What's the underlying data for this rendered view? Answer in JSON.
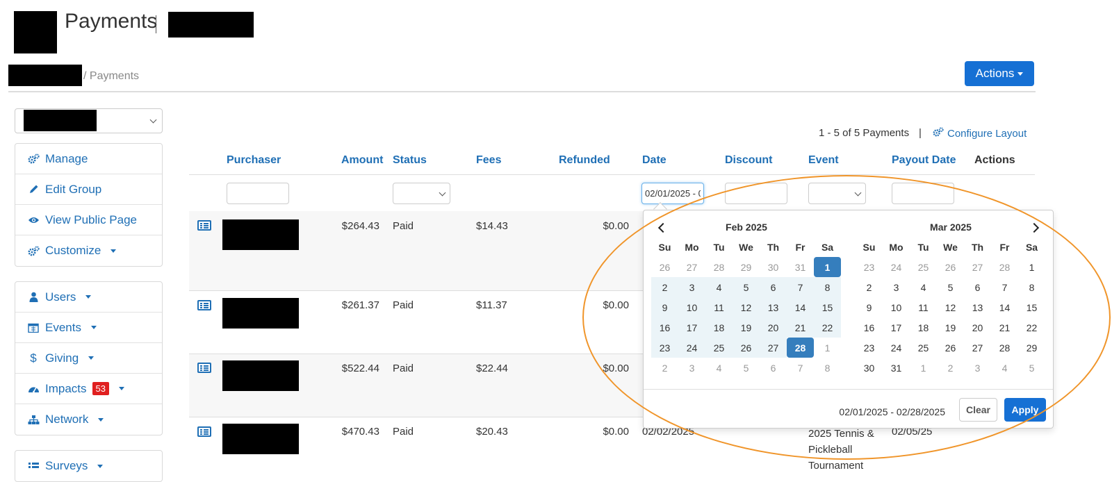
{
  "header": {
    "title": "Payments"
  },
  "breadcrumb": {
    "current": "/ Payments"
  },
  "actions_button": {
    "label": "Actions"
  },
  "sidebar": {
    "group1": [
      {
        "label": "Manage",
        "icon": "cogs-icon"
      },
      {
        "label": "Edit Group",
        "icon": "pencil-icon"
      },
      {
        "label": "View Public Page",
        "icon": "eye-icon"
      },
      {
        "label": "Customize",
        "icon": "cogs-icon"
      }
    ],
    "group2": [
      {
        "label": "Users",
        "icon": "user-icon"
      },
      {
        "label": "Events",
        "icon": "calendar-icon"
      },
      {
        "label": "Giving",
        "icon": "dollar-icon"
      },
      {
        "label": "Impacts",
        "icon": "dashboard-icon",
        "badge": "53"
      },
      {
        "label": "Network",
        "icon": "sitemap-icon"
      }
    ],
    "group3": [
      {
        "label": "Surveys",
        "icon": "list-icon"
      }
    ]
  },
  "summary": {
    "count_text": "1 - 5 of 5 Payments",
    "separator": "|",
    "configure_label": "Configure Layout"
  },
  "table": {
    "headers": {
      "purchaser": "Purchaser",
      "amount": "Amount",
      "status": "Status",
      "fees": "Fees",
      "refunded": "Refunded",
      "date": "Date",
      "discount": "Discount",
      "event": "Event",
      "payout_date": "Payout Date",
      "actions": "Actions"
    },
    "date_filter_value": "02/01/2025 - 02/28/2025",
    "rows": [
      {
        "amount": "$264.43",
        "status": "Paid",
        "fees": "$14.43",
        "refunded": "$0.00"
      },
      {
        "amount": "$261.37",
        "status": "Paid",
        "fees": "$11.37",
        "refunded": "$0.00"
      },
      {
        "amount": "$522.44",
        "status": "Paid",
        "fees": "$22.44",
        "refunded": "$0.00"
      },
      {
        "amount": "$470.43",
        "status": "Paid",
        "fees": "$20.43",
        "refunded": "$0.00",
        "date": "02/02/2025",
        "event": "2025 Tennis & Pickleball Tournament",
        "payout_date": "02/05/25"
      }
    ]
  },
  "datepicker": {
    "dow": [
      "Su",
      "Mo",
      "Tu",
      "We",
      "Th",
      "Fr",
      "Sa"
    ],
    "months": [
      {
        "label": "Feb 2025",
        "days": [
          [
            "26",
            "off"
          ],
          [
            "27",
            "off"
          ],
          [
            "28",
            "off"
          ],
          [
            "29",
            "off"
          ],
          [
            "30",
            "off"
          ],
          [
            "31",
            "off"
          ],
          [
            "1",
            "sel"
          ],
          [
            "2",
            "in"
          ],
          [
            "3",
            "in"
          ],
          [
            "4",
            "in"
          ],
          [
            "5",
            "in"
          ],
          [
            "6",
            "in"
          ],
          [
            "7",
            "in"
          ],
          [
            "8",
            "in"
          ],
          [
            "9",
            "in"
          ],
          [
            "10",
            "in"
          ],
          [
            "11",
            "in"
          ],
          [
            "12",
            "in"
          ],
          [
            "13",
            "in"
          ],
          [
            "14",
            "in"
          ],
          [
            "15",
            "in"
          ],
          [
            "16",
            "in"
          ],
          [
            "17",
            "in"
          ],
          [
            "18",
            "in"
          ],
          [
            "19",
            "in"
          ],
          [
            "20",
            "in"
          ],
          [
            "21",
            "in"
          ],
          [
            "22",
            "in"
          ],
          [
            "23",
            "in"
          ],
          [
            "24",
            "in"
          ],
          [
            "25",
            "in"
          ],
          [
            "26",
            "in"
          ],
          [
            "27",
            "in"
          ],
          [
            "28",
            "sel"
          ],
          [
            "1",
            "off"
          ],
          [
            "2",
            "off"
          ],
          [
            "3",
            "off"
          ],
          [
            "4",
            "off"
          ],
          [
            "5",
            "off"
          ],
          [
            "6",
            "off"
          ],
          [
            "7",
            "off"
          ],
          [
            "8",
            "off"
          ]
        ]
      },
      {
        "label": "Mar 2025",
        "days": [
          [
            "23",
            "off"
          ],
          [
            "24",
            "off"
          ],
          [
            "25",
            "off"
          ],
          [
            "26",
            "off"
          ],
          [
            "27",
            "off"
          ],
          [
            "28",
            "off"
          ],
          [
            "1",
            ""
          ],
          [
            "2",
            ""
          ],
          [
            "3",
            ""
          ],
          [
            "4",
            ""
          ],
          [
            "5",
            ""
          ],
          [
            "6",
            ""
          ],
          [
            "7",
            ""
          ],
          [
            "8",
            ""
          ],
          [
            "9",
            ""
          ],
          [
            "10",
            ""
          ],
          [
            "11",
            ""
          ],
          [
            "12",
            ""
          ],
          [
            "13",
            ""
          ],
          [
            "14",
            ""
          ],
          [
            "15",
            ""
          ],
          [
            "16",
            ""
          ],
          [
            "17",
            ""
          ],
          [
            "18",
            ""
          ],
          [
            "19",
            ""
          ],
          [
            "20",
            ""
          ],
          [
            "21",
            ""
          ],
          [
            "22",
            ""
          ],
          [
            "23",
            ""
          ],
          [
            "24",
            ""
          ],
          [
            "25",
            ""
          ],
          [
            "26",
            ""
          ],
          [
            "27",
            ""
          ],
          [
            "28",
            ""
          ],
          [
            "29",
            ""
          ],
          [
            "30",
            ""
          ],
          [
            "31",
            ""
          ],
          [
            "1",
            "off"
          ],
          [
            "2",
            "off"
          ],
          [
            "3",
            "off"
          ],
          [
            "4",
            "off"
          ],
          [
            "5",
            "off"
          ]
        ]
      }
    ],
    "range_text": "02/01/2025 - 02/28/2025",
    "clear_label": "Clear",
    "apply_label": "Apply"
  }
}
